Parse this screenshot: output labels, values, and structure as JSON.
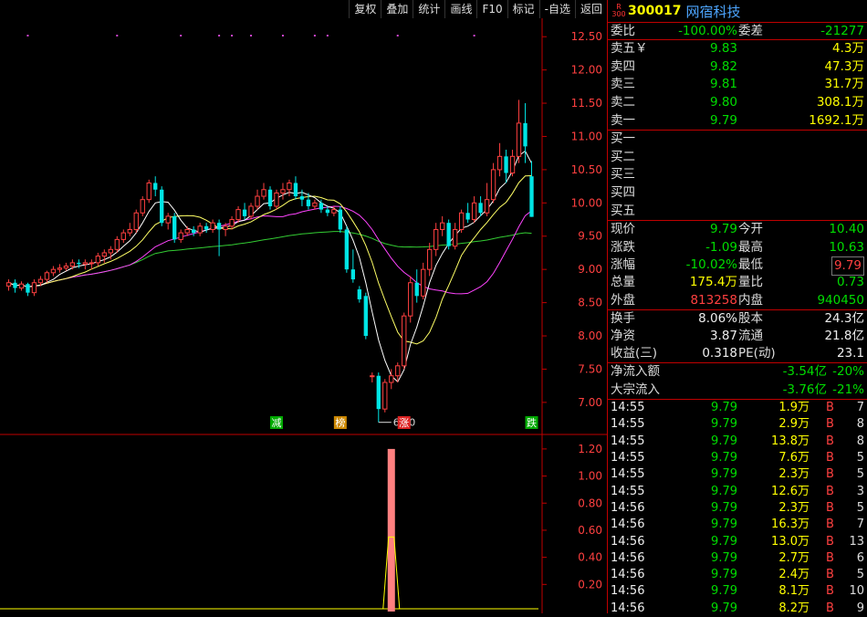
{
  "toolbar": [
    "复权",
    "叠加",
    "统计",
    "画线",
    "F10",
    "标记",
    "-自选",
    "返回"
  ],
  "stock": {
    "board_badge_top": "R",
    "board_badge_bottom": "300",
    "code": "300017",
    "name": "网宿科技"
  },
  "weibi": {
    "label": "委比",
    "value": "-100.00%",
    "label2": "委差",
    "value2": "-21277"
  },
  "asks": [
    {
      "label": "卖五￥",
      "price": "9.83",
      "vol": "4.3万"
    },
    {
      "label": "卖四",
      "price": "9.82",
      "vol": "47.3万"
    },
    {
      "label": "卖三",
      "price": "9.81",
      "vol": "31.7万"
    },
    {
      "label": "卖二",
      "price": "9.80",
      "vol": "308.1万"
    },
    {
      "label": "卖一",
      "price": "9.79",
      "vol": "1692.1万"
    }
  ],
  "bids": [
    {
      "label": "买一",
      "price": "",
      "vol": ""
    },
    {
      "label": "买二",
      "price": "",
      "vol": ""
    },
    {
      "label": "买三",
      "price": "",
      "vol": ""
    },
    {
      "label": "买四",
      "price": "",
      "vol": ""
    },
    {
      "label": "买五",
      "price": "",
      "vol": ""
    }
  ],
  "quote": [
    {
      "l1": "现价",
      "v1": "9.79",
      "c1": "g",
      "l2": "今开",
      "v2": "10.40",
      "c2": "g"
    },
    {
      "l1": "涨跌",
      "v1": "-1.09",
      "c1": "g",
      "l2": "最高",
      "v2": "10.63",
      "c2": "g"
    },
    {
      "l1": "涨幅",
      "v1": "-10.02%",
      "c1": "g",
      "l2": "最低",
      "v2": "9.79",
      "c2": "box"
    },
    {
      "l1": "总量",
      "v1": "175.4万",
      "c1": "y",
      "l2": "量比",
      "v2": "0.73",
      "c2": "g"
    },
    {
      "l1": "外盘",
      "v1": "813258",
      "c1": "r",
      "l2": "内盘",
      "v2": "940450",
      "c2": "g"
    }
  ],
  "fund": [
    {
      "l1": "换手",
      "v1": "8.06%",
      "l2": "股本",
      "v2": "24.3亿"
    },
    {
      "l1": "净资",
      "v1": "3.87",
      "l2": "流通",
      "v2": "21.8亿"
    },
    {
      "l1": "收益(三)",
      "v1": "0.318",
      "l2": "PE(动)",
      "v2": "23.1"
    }
  ],
  "flow": [
    {
      "label": "净流入额",
      "value": "-3.54亿",
      "pct": "-20%"
    },
    {
      "label": "大宗流入",
      "value": "-3.76亿",
      "pct": "-21%"
    }
  ],
  "ticks": [
    {
      "time": "14:55",
      "price": "9.79",
      "vol": "1.9万",
      "side": "B",
      "n": "7"
    },
    {
      "time": "14:55",
      "price": "9.79",
      "vol": "2.9万",
      "side": "B",
      "n": "8"
    },
    {
      "time": "14:55",
      "price": "9.79",
      "vol": "13.8万",
      "side": "B",
      "n": "8"
    },
    {
      "time": "14:55",
      "price": "9.79",
      "vol": "7.6万",
      "side": "B",
      "n": "5"
    },
    {
      "time": "14:55",
      "price": "9.79",
      "vol": "2.3万",
      "side": "B",
      "n": "5"
    },
    {
      "time": "14:55",
      "price": "9.79",
      "vol": "12.6万",
      "side": "B",
      "n": "3"
    },
    {
      "time": "14:56",
      "price": "9.79",
      "vol": "2.3万",
      "side": "B",
      "n": "5"
    },
    {
      "time": "14:56",
      "price": "9.79",
      "vol": "16.3万",
      "side": "B",
      "n": "7"
    },
    {
      "time": "14:56",
      "price": "9.79",
      "vol": "13.0万",
      "side": "B",
      "n": "13"
    },
    {
      "time": "14:56",
      "price": "9.79",
      "vol": "2.7万",
      "side": "B",
      "n": "6"
    },
    {
      "time": "14:56",
      "price": "9.79",
      "vol": "2.4万",
      "side": "B",
      "n": "5"
    },
    {
      "time": "14:56",
      "price": "9.79",
      "vol": "8.1万",
      "side": "B",
      "n": "10"
    },
    {
      "time": "14:56",
      "price": "9.79",
      "vol": "8.2万",
      "side": "B",
      "n": "9"
    }
  ],
  "colors": {
    "up": "#ff4040",
    "down": "#00e5e5",
    "ma5": "#ffffff",
    "ma10": "#ffff66",
    "ma20": "#ff44ff",
    "ma60": "#33cc33",
    "indicator": "#ff8080",
    "indicator_line": "#ffff00",
    "frame": "#c00000"
  },
  "chart_data": {
    "type": "candlestick",
    "price_axis": [
      "12.50",
      "12.00",
      "11.50",
      "11.00",
      "10.50",
      "10.00",
      "9.50",
      "9.00",
      "8.50",
      "8.00",
      "7.50",
      "7.00"
    ],
    "price_range": [
      6.6,
      12.75
    ],
    "low_annotation": "6.70",
    "markers": [
      {
        "text": "减",
        "index": 42,
        "color": "#00aa00"
      },
      {
        "text": "榜",
        "index": 52,
        "color": "#cc8800"
      },
      {
        "text": "涨",
        "index": 62,
        "color": "#dd2222"
      },
      {
        "text": "跌",
        "index": 82,
        "color": "#00aa00"
      }
    ],
    "indicator_axis": [
      "1.20",
      "1.00",
      "0.80",
      "0.60",
      "0.40",
      "0.20"
    ],
    "indicator_range": [
      0,
      1.28
    ],
    "indicator_spike": {
      "index": 60,
      "value": 1.2
    },
    "candles": [
      [
        8.75,
        8.8,
        8.68,
        8.85
      ],
      [
        8.8,
        8.72,
        8.65,
        8.85
      ],
      [
        8.72,
        8.78,
        8.68,
        8.82
      ],
      [
        8.78,
        8.65,
        8.6,
        8.8
      ],
      [
        8.65,
        8.8,
        8.6,
        8.85
      ],
      [
        8.8,
        8.85,
        8.75,
        8.9
      ],
      [
        8.85,
        8.95,
        8.8,
        8.98
      ],
      [
        8.95,
        9.0,
        8.9,
        9.05
      ],
      [
        9.0,
        9.02,
        8.95,
        9.08
      ],
      [
        9.02,
        9.05,
        8.98,
        9.1
      ],
      [
        9.05,
        9.1,
        9.0,
        9.15
      ],
      [
        9.1,
        9.08,
        9.02,
        9.15
      ],
      [
        9.08,
        9.1,
        9.0,
        9.15
      ],
      [
        9.1,
        9.1,
        9.0,
        9.15
      ],
      [
        9.1,
        9.2,
        9.05,
        9.25
      ],
      [
        9.2,
        9.25,
        9.1,
        9.3
      ],
      [
        9.25,
        9.3,
        9.15,
        9.35
      ],
      [
        9.3,
        9.45,
        9.25,
        9.5
      ],
      [
        9.45,
        9.55,
        9.4,
        9.6
      ],
      [
        9.55,
        9.6,
        9.5,
        9.7
      ],
      [
        9.6,
        9.85,
        9.55,
        9.9
      ],
      [
        9.85,
        10.05,
        9.8,
        10.1
      ],
      [
        10.05,
        10.3,
        10.0,
        10.35
      ],
      [
        10.3,
        10.2,
        10.1,
        10.4
      ],
      [
        10.2,
        9.7,
        9.65,
        10.25
      ],
      [
        9.7,
        9.8,
        9.6,
        9.85
      ],
      [
        9.8,
        9.45,
        9.4,
        9.85
      ],
      [
        9.45,
        9.55,
        9.4,
        9.6
      ],
      [
        9.55,
        9.6,
        9.5,
        9.65
      ],
      [
        9.6,
        9.55,
        9.5,
        9.65
      ],
      [
        9.55,
        9.65,
        9.5,
        9.7
      ],
      [
        9.65,
        9.6,
        9.55,
        9.7
      ],
      [
        9.6,
        9.7,
        9.55,
        9.75
      ],
      [
        9.7,
        9.6,
        9.2,
        9.75
      ],
      [
        9.6,
        9.65,
        9.5,
        9.7
      ],
      [
        9.65,
        9.75,
        9.6,
        9.8
      ],
      [
        9.75,
        9.9,
        9.7,
        9.95
      ],
      [
        9.9,
        9.8,
        9.75,
        10.0
      ],
      [
        9.8,
        9.95,
        9.75,
        10.0
      ],
      [
        9.95,
        10.1,
        9.9,
        10.2
      ],
      [
        10.1,
        10.2,
        10.05,
        10.3
      ],
      [
        10.2,
        9.95,
        9.9,
        10.25
      ],
      [
        9.95,
        10.15,
        9.9,
        10.2
      ],
      [
        10.15,
        10.2,
        10.05,
        10.3
      ],
      [
        10.2,
        10.3,
        10.1,
        10.35
      ],
      [
        10.3,
        10.1,
        10.05,
        10.4
      ],
      [
        10.1,
        10.05,
        9.95,
        10.2
      ],
      [
        10.05,
        9.95,
        9.9,
        10.15
      ],
      [
        9.95,
        10.0,
        9.9,
        10.05
      ],
      [
        10.0,
        9.9,
        9.85,
        10.05
      ],
      [
        9.9,
        9.85,
        9.8,
        9.95
      ],
      [
        9.85,
        9.9,
        9.8,
        9.95
      ],
      [
        9.9,
        9.6,
        9.55,
        9.95
      ],
      [
        9.6,
        9.0,
        8.95,
        9.65
      ],
      [
        9.0,
        8.85,
        8.8,
        9.3
      ],
      [
        8.7,
        8.55,
        8.5,
        8.75
      ],
      [
        8.6,
        8.0,
        7.95,
        8.65
      ],
      [
        7.4,
        7.4,
        7.3,
        7.45
      ],
      [
        7.4,
        6.9,
        6.7,
        7.45
      ],
      [
        6.9,
        7.3,
        6.85,
        7.35
      ],
      [
        7.3,
        7.4,
        7.2,
        7.5
      ],
      [
        7.4,
        7.55,
        7.3,
        7.6
      ],
      [
        7.55,
        8.3,
        7.5,
        8.35
      ],
      [
        8.3,
        8.8,
        8.2,
        8.9
      ],
      [
        8.8,
        8.6,
        8.5,
        9.0
      ],
      [
        8.6,
        9.0,
        8.55,
        9.1
      ],
      [
        9.0,
        9.3,
        8.9,
        9.4
      ],
      [
        9.3,
        9.6,
        9.2,
        9.7
      ],
      [
        9.6,
        9.7,
        9.5,
        9.8
      ],
      [
        9.7,
        9.35,
        9.3,
        9.75
      ],
      [
        9.35,
        9.6,
        9.3,
        9.7
      ],
      [
        9.6,
        9.85,
        9.55,
        9.9
      ],
      [
        9.85,
        9.75,
        9.7,
        10.0
      ],
      [
        9.75,
        10.0,
        9.7,
        10.1
      ],
      [
        10.0,
        9.85,
        9.8,
        10.1
      ],
      [
        9.85,
        10.05,
        9.8,
        10.3
      ],
      [
        10.05,
        10.5,
        10.0,
        10.6
      ],
      [
        10.5,
        10.7,
        10.4,
        10.9
      ],
      [
        10.7,
        10.45,
        10.3,
        10.8
      ],
      [
        10.45,
        10.7,
        10.4,
        10.8
      ],
      [
        10.7,
        11.2,
        10.6,
        11.55
      ],
      [
        11.2,
        10.85,
        10.6,
        11.5
      ],
      [
        10.4,
        9.79,
        9.79,
        10.63
      ]
    ]
  }
}
